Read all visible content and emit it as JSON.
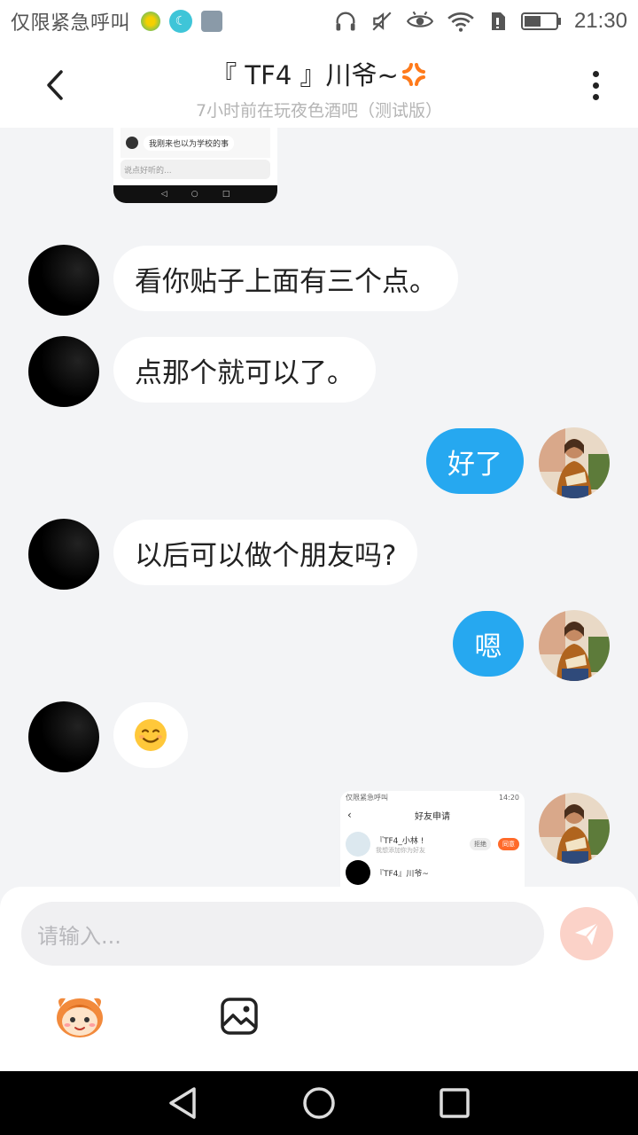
{
  "status_bar": {
    "carrier": "仅限紧急呼叫",
    "time": "21:30",
    "icons": [
      "headphones-icon",
      "mute-icon",
      "eye-icon",
      "wifi-icon",
      "sim-icon",
      "battery-icon"
    ]
  },
  "header": {
    "title": "『 TF4 』川爷~",
    "title_emoji": "anger-emoji",
    "subtitle": "7小时前在玩夜色酒吧（测试版）"
  },
  "colors": {
    "bubble_out": "#26a8f0",
    "bubble_in": "#ffffff",
    "background": "#f3f4f6",
    "send_button": "#fbd2c8"
  },
  "image_top": {
    "comment": "我刚来也以为学校的事",
    "input_hint": "说点好听的..."
  },
  "messages": [
    {
      "side": "in",
      "text": "看你贴子上面有三个点。"
    },
    {
      "side": "in",
      "text": "点那个就可以了。"
    },
    {
      "side": "out",
      "text": "好了"
    },
    {
      "side": "in",
      "text": "以后可以做个朋友吗?"
    },
    {
      "side": "out",
      "text": "嗯"
    },
    {
      "side": "in",
      "text": "😊"
    }
  ],
  "image_bottom": {
    "status_left": "仅限紧急呼叫",
    "status_time": "14:20",
    "title": "好友申请",
    "row1_name": "『TF4_小林 !",
    "row1_sub": "我想添加你为好友",
    "reject": "拒绝",
    "accept": "同意",
    "row2_name": "『TF4』川爷~"
  },
  "input": {
    "placeholder": "请输入..."
  },
  "toolbar": {
    "mascot": "mascot-icon",
    "image": "image-icon"
  }
}
